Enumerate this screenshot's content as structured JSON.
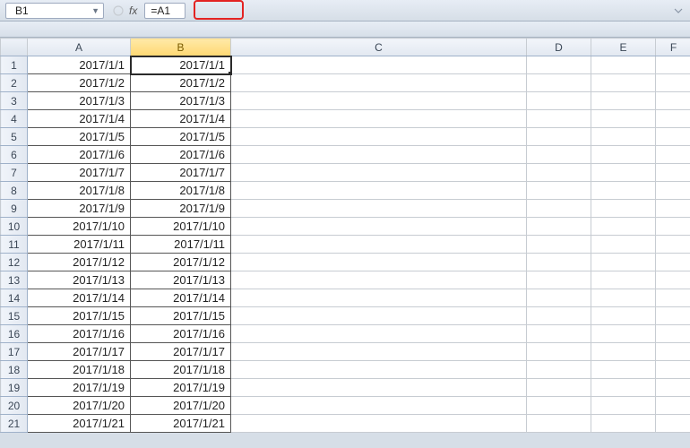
{
  "name_box": {
    "value": "B1"
  },
  "formula": {
    "value": "=A1"
  },
  "fx_label": "fx",
  "columns": [
    "A",
    "B",
    "C",
    "D",
    "E",
    "F"
  ],
  "selected_column": "B",
  "active_cell": {
    "row": 1,
    "col": "B"
  },
  "rows": [
    {
      "n": 1,
      "A": "2017/1/1",
      "B": "2017/1/1"
    },
    {
      "n": 2,
      "A": "2017/1/2",
      "B": "2017/1/2"
    },
    {
      "n": 3,
      "A": "2017/1/3",
      "B": "2017/1/3"
    },
    {
      "n": 4,
      "A": "2017/1/4",
      "B": "2017/1/4"
    },
    {
      "n": 5,
      "A": "2017/1/5",
      "B": "2017/1/5"
    },
    {
      "n": 6,
      "A": "2017/1/6",
      "B": "2017/1/6"
    },
    {
      "n": 7,
      "A": "2017/1/7",
      "B": "2017/1/7"
    },
    {
      "n": 8,
      "A": "2017/1/8",
      "B": "2017/1/8"
    },
    {
      "n": 9,
      "A": "2017/1/9",
      "B": "2017/1/9"
    },
    {
      "n": 10,
      "A": "2017/1/10",
      "B": "2017/1/10"
    },
    {
      "n": 11,
      "A": "2017/1/11",
      "B": "2017/1/11"
    },
    {
      "n": 12,
      "A": "2017/1/12",
      "B": "2017/1/12"
    },
    {
      "n": 13,
      "A": "2017/1/13",
      "B": "2017/1/13"
    },
    {
      "n": 14,
      "A": "2017/1/14",
      "B": "2017/1/14"
    },
    {
      "n": 15,
      "A": "2017/1/15",
      "B": "2017/1/15"
    },
    {
      "n": 16,
      "A": "2017/1/16",
      "B": "2017/1/16"
    },
    {
      "n": 17,
      "A": "2017/1/17",
      "B": "2017/1/17"
    },
    {
      "n": 18,
      "A": "2017/1/18",
      "B": "2017/1/18"
    },
    {
      "n": 19,
      "A": "2017/1/19",
      "B": "2017/1/19"
    },
    {
      "n": 20,
      "A": "2017/1/20",
      "B": "2017/1/20"
    },
    {
      "n": 21,
      "A": "2017/1/21",
      "B": "2017/1/21"
    }
  ]
}
